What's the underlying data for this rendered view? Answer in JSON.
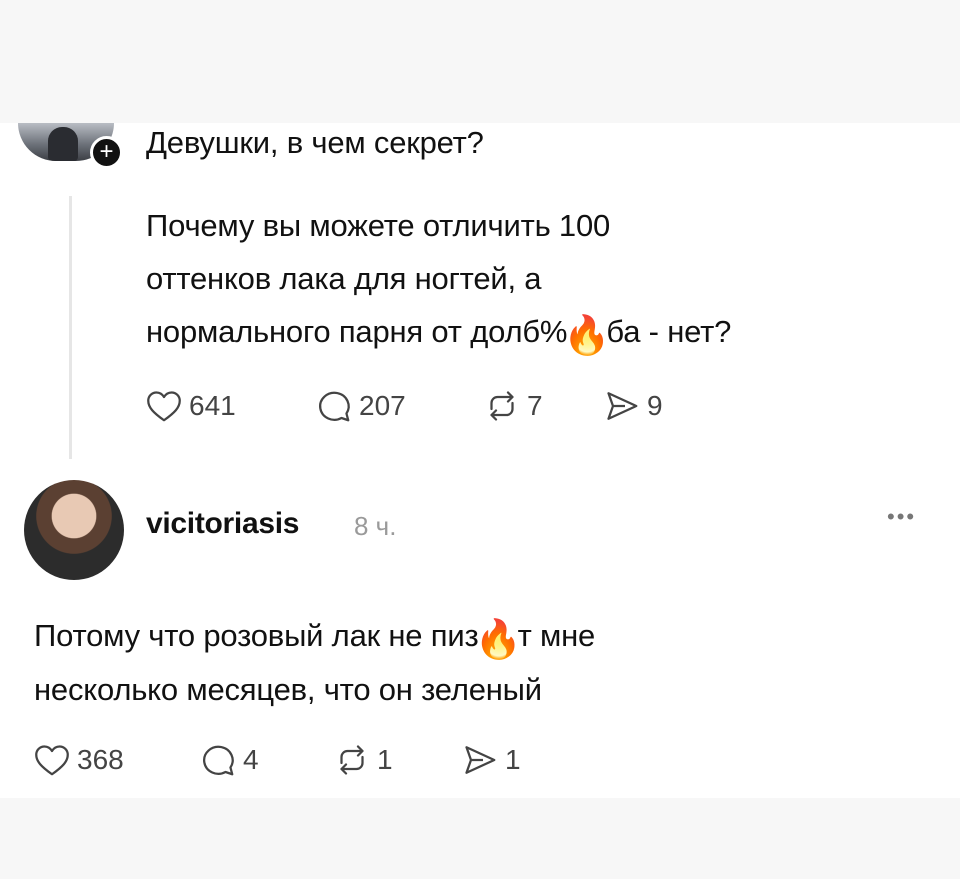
{
  "post": {
    "title": "Девушки, в чем секрет?",
    "add_symbol": "+",
    "body_line1": "Почему вы  можете  отличить 100",
    "body_line2": "оттенков лака для ногтей, а",
    "body_line3_a": "нормального парня от долб%",
    "body_line3_emoji": "🔥",
    "body_line3_b": "ба - нет?",
    "likes": "641",
    "comments": "207",
    "reposts": "7",
    "shares": "9"
  },
  "reply": {
    "username": "vicitoriasis",
    "time": "8 ч.",
    "more_label": "•••",
    "line1_a": "Потому что розовый лак не пиз",
    "line1_emoji": "🔥",
    "line1_b": "т мне",
    "line2": "несколько месяцев, что он зеленый",
    "likes": "368",
    "comments": "4",
    "reposts": "1",
    "shares": "1"
  },
  "icons": [
    "heart-icon",
    "comment-icon",
    "repost-icon",
    "share-icon",
    "plus-icon",
    "more-icon"
  ]
}
